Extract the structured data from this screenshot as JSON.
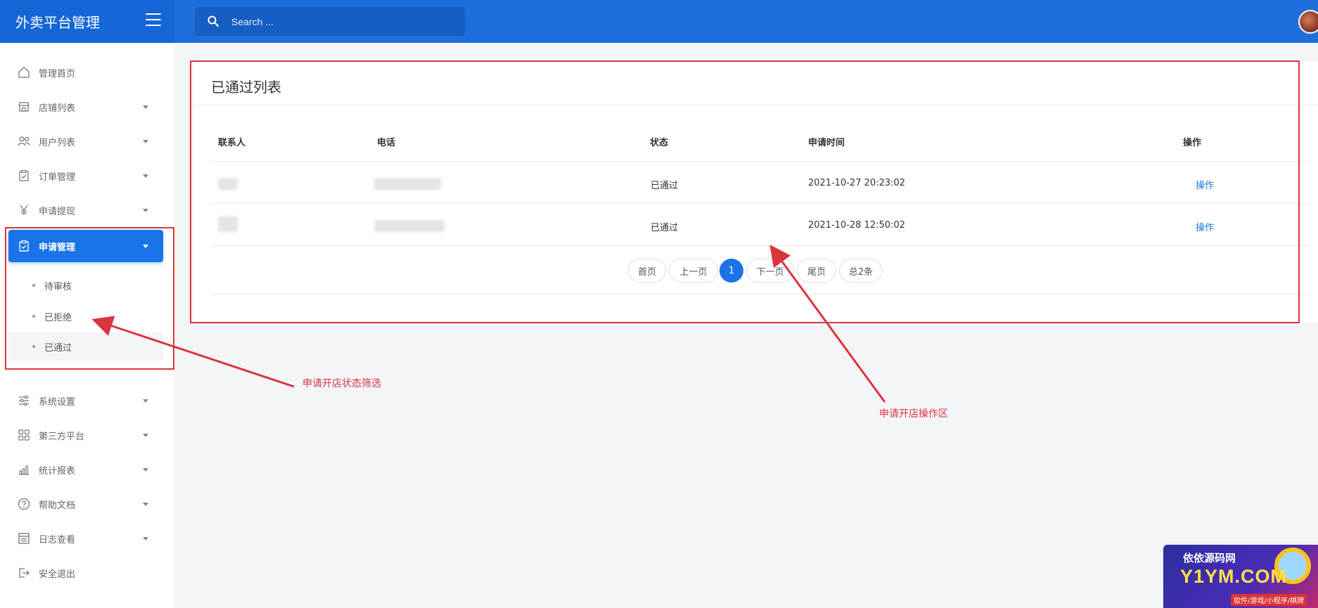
{
  "header": {
    "brand_title": "外卖平台管理",
    "search_placeholder": "Search ..."
  },
  "sidebar": {
    "items": [
      {
        "label": "管理首页",
        "icon": "home-icon"
      },
      {
        "label": "店铺列表",
        "icon": "store-icon"
      },
      {
        "label": "用户列表",
        "icon": "users-icon"
      },
      {
        "label": "订单管理",
        "icon": "clipboard-icon"
      },
      {
        "label": "申请提现",
        "icon": "yen-icon"
      },
      {
        "label": "申请管理",
        "icon": "clipboard-check-icon"
      },
      {
        "label": "系统设置",
        "icon": "sliders-icon"
      },
      {
        "label": "第三方平台",
        "icon": "grid-icon"
      },
      {
        "label": "统计报表",
        "icon": "bar-chart-icon"
      },
      {
        "label": "帮助文档",
        "icon": "help-icon"
      },
      {
        "label": "日志查看",
        "icon": "log-icon"
      },
      {
        "label": "安全退出",
        "icon": "logout-icon"
      }
    ],
    "submenu": [
      {
        "label": "待审核"
      },
      {
        "label": "已拒绝"
      },
      {
        "label": "已通过"
      }
    ]
  },
  "main": {
    "title": "已通过列表",
    "columns": [
      "联系人",
      "电话",
      "状态",
      "申请时间",
      "操作"
    ],
    "rows": [
      {
        "status": "已通过",
        "time": "2021-10-27 20:23:02",
        "action": "操作"
      },
      {
        "status": "已通过",
        "time": "2021-10-28 12:50:02",
        "action": "操作"
      }
    ],
    "pager": {
      "first": "首页",
      "prev": "上一页",
      "current": "1",
      "next": "下一页",
      "last": "尾页",
      "total": "总2条"
    }
  },
  "annotations": {
    "filter_label": "申请开店状态筛选",
    "action_label": "申请开店操作区"
  },
  "watermark": {
    "line1": "依依源码网",
    "line2": "Y1YM.COM",
    "line3": "软件/游戏/小程序/棋牌"
  },
  "colors": {
    "topbar": "#1d6fdc",
    "accent": "#1a73e8",
    "annotation": "#d9363e"
  }
}
